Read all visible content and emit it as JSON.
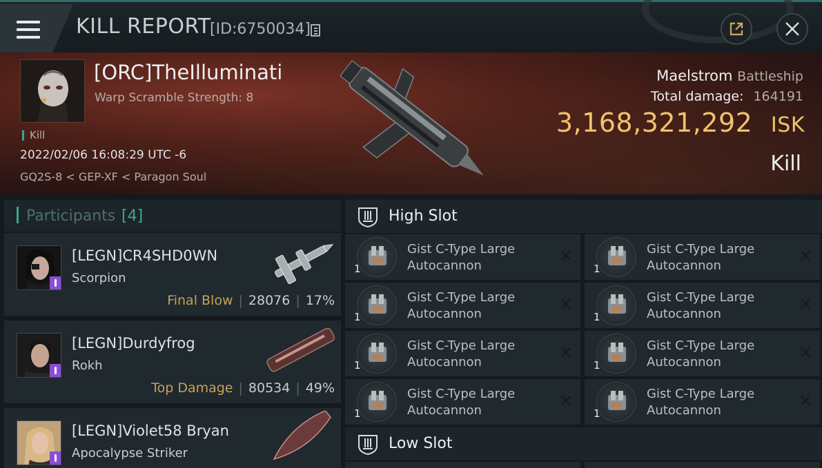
{
  "titlebar": {
    "title": "KILL REPORT",
    "kill_id": "[ID:6750034]",
    "icons": [
      "menu-icon",
      "copy-icon",
      "share-icon",
      "close-icon"
    ]
  },
  "victim": {
    "name": "[ORC]TheIlluminati",
    "scramble": "Warp Scramble Strength: 8",
    "tag": "Kill",
    "date": "2022/02/06 16:08:29 UTC -6",
    "location": "GQ2S-8 < GEP-XF < Paragon Soul",
    "ship": "Maelstrom",
    "ship_class": "Battleship",
    "damage_label": "Total damage:",
    "damage_value": "164191",
    "isk_value": "3,168,321,292",
    "isk_unit": "ISK",
    "result": "Kill"
  },
  "participants": {
    "title": "Participants",
    "count": "[4]",
    "list": [
      {
        "name": "[LEGN]CR4SHD0WN",
        "ship": "Scorpion",
        "role": "Final Blow",
        "damage": "28076",
        "percent": "17%"
      },
      {
        "name": "[LEGN]Durdyfrog",
        "ship": "Rokh",
        "role": "Top Damage",
        "damage": "80534",
        "percent": "49%"
      },
      {
        "name": "[LEGN]Violet58 Bryan",
        "ship": "Apocalypse Striker",
        "role": "",
        "damage": "",
        "percent": ""
      }
    ]
  },
  "fitting": {
    "high_slot_title": "High Slot",
    "low_slot_title": "Low Slot",
    "high_modules": [
      {
        "name": "Gist C-Type Large Autocannon",
        "qty": "1"
      },
      {
        "name": "Gist C-Type Large Autocannon",
        "qty": "1"
      },
      {
        "name": "Gist C-Type Large Autocannon",
        "qty": "1"
      },
      {
        "name": "Gist C-Type Large Autocannon",
        "qty": "1"
      },
      {
        "name": "Gist C-Type Large Autocannon",
        "qty": "1"
      },
      {
        "name": "Gist C-Type Large Autocannon",
        "qty": "1"
      },
      {
        "name": "Gist C-Type Large Autocannon",
        "qty": "1"
      },
      {
        "name": "Gist C-Type Large Autocannon",
        "qty": "1"
      }
    ]
  },
  "colors": {
    "accent": "#3aa890",
    "isk": "#f0c36c",
    "role": "#c9a05a",
    "badge": "#8a4ed6"
  }
}
